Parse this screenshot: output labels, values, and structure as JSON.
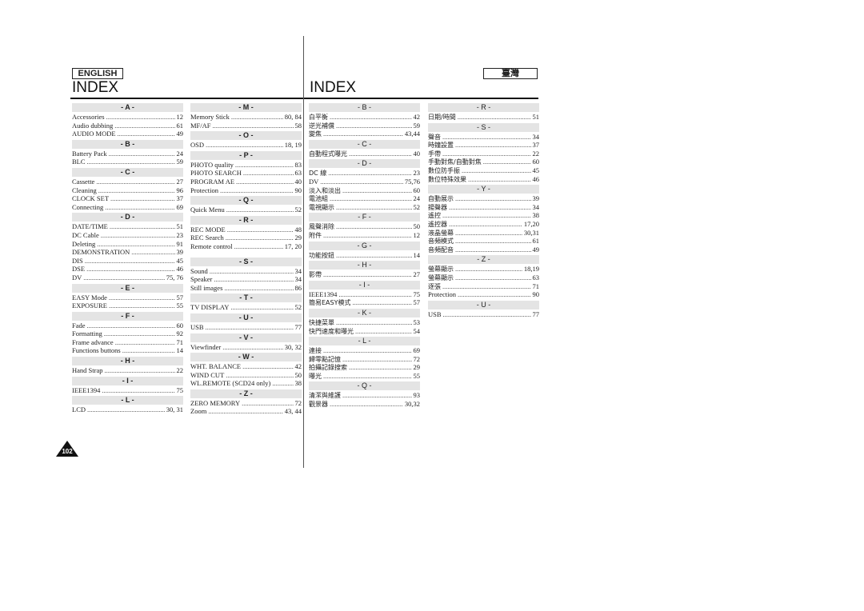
{
  "header": {
    "left_lang": "ENGLISH",
    "right_lang": "臺灣",
    "left_title": "INDEX",
    "right_title": "INDEX"
  },
  "page_number": "102",
  "col1": [
    {
      "letter": "- A -",
      "items": [
        [
          "Accessories",
          "12"
        ],
        [
          "Audio dubbing",
          "61"
        ],
        [
          "AUDIO MODE",
          "49"
        ]
      ]
    },
    {
      "letter": "- B -",
      "items": [
        [
          "Battery Pack",
          "24"
        ],
        [
          "BLC",
          "59"
        ]
      ]
    },
    {
      "letter": "- C -",
      "items": [
        [
          "Cassette",
          "27"
        ],
        [
          "Cleaning",
          "96"
        ],
        [
          "CLOCK SET",
          "37"
        ],
        [
          "Connecting",
          "69"
        ]
      ]
    },
    {
      "letter": "- D -",
      "items": [
        [
          "DATE/TIME",
          "51"
        ],
        [
          "DC Cable",
          "23"
        ],
        [
          "Deleting",
          "91"
        ],
        [
          "DEMONSTRATION",
          "39"
        ],
        [
          "DIS",
          "45"
        ],
        [
          "DSE",
          "46"
        ],
        [
          "DV",
          "75, 76"
        ]
      ]
    },
    {
      "letter": "- E -",
      "items": [
        [
          "EASY Mode",
          "57"
        ],
        [
          "EXPOSURE",
          "55"
        ]
      ]
    },
    {
      "letter": "- F -",
      "items": [
        [
          "Fade",
          "60"
        ],
        [
          "Formatting",
          "92"
        ],
        [
          "Frame advance",
          "71"
        ],
        [
          "Functions buttons",
          "14"
        ]
      ]
    },
    {
      "letter": "- H -",
      "items": [
        [
          "Hand Strap",
          "22"
        ]
      ]
    },
    {
      "letter": "- I -",
      "items": [
        [
          "IEEE1394",
          "75"
        ]
      ]
    },
    {
      "letter": "- L -",
      "items": [
        [
          "LCD",
          "30, 31"
        ]
      ]
    }
  ],
  "col2": [
    {
      "letter": "- M -",
      "items": [
        [
          "Memory Stick",
          "80, 84"
        ],
        [
          "MF/AF",
          "58"
        ]
      ]
    },
    {
      "letter": "- O -",
      "items": [
        [
          "OSD",
          "18, 19"
        ]
      ]
    },
    {
      "letter": "- P -",
      "items": [
        [
          "PHOTO quality",
          "83"
        ],
        [
          "PHOTO SEARCH",
          "63"
        ],
        [
          "PROGRAM AE",
          "40"
        ],
        [
          "Protection",
          "90"
        ]
      ]
    },
    {
      "letter": "- Q -",
      "items": [
        [
          "Quick Menu",
          "52"
        ]
      ]
    },
    {
      "letter": "- R -",
      "items": [
        [
          "REC MODE",
          "48"
        ],
        [
          "REC Search",
          "29"
        ],
        [
          "Remote control",
          "17, 20"
        ]
      ]
    },
    {
      "letter": "- S -",
      "items": [
        [
          "Sound",
          "34"
        ],
        [
          "Speaker",
          "34"
        ],
        [
          "Still images",
          "86"
        ]
      ]
    },
    {
      "letter": "- T -",
      "items": [
        [
          "TV DISPLAY",
          "52"
        ]
      ]
    },
    {
      "letter": "- U -",
      "items": [
        [
          "USB",
          "77"
        ]
      ]
    },
    {
      "letter": "- V -",
      "items": [
        [
          "Viewfinder",
          "30, 32"
        ]
      ]
    },
    {
      "letter": "- W -",
      "items": [
        [
          "WHT. BALANCE",
          "42"
        ],
        [
          "WIND CUT",
          "50"
        ],
        [
          "WL.REMOTE (SCD24 only)",
          "38"
        ]
      ]
    },
    {
      "letter": "- Z -",
      "items": [
        [
          "ZERO MEMORY",
          "72"
        ],
        [
          "Zoom",
          "43, 44"
        ]
      ]
    }
  ],
  "col3": [
    {
      "letter": "- B -",
      "items": [
        [
          "白平衡",
          "42"
        ],
        [
          "逆光補償",
          "59"
        ],
        [
          "變焦",
          "43,44"
        ]
      ]
    },
    {
      "letter": "- C -",
      "items": [
        [
          "自動程式曝光",
          "40"
        ]
      ]
    },
    {
      "letter": "- D -",
      "items": [
        [
          "DC 線",
          "23"
        ],
        [
          "DV",
          "75,76"
        ],
        [
          "淡入和淡出",
          "60"
        ],
        [
          "電池組",
          "24"
        ],
        [
          "電視顯示",
          "52"
        ]
      ]
    },
    {
      "letter": "- F -",
      "items": [
        [
          "風聲消除",
          "50"
        ],
        [
          "附件",
          "12"
        ]
      ]
    },
    {
      "letter": "- G -",
      "items": [
        [
          "功能按鈕",
          "14"
        ]
      ]
    },
    {
      "letter": "- H -",
      "items": [
        [
          "影帶",
          "27"
        ]
      ]
    },
    {
      "letter": "- I -",
      "items": [
        [
          "IEEE1394",
          "75"
        ],
        [
          "簡易EASY模式",
          "57"
        ]
      ]
    },
    {
      "letter": "- K -",
      "items": [
        [
          "快捷菜單",
          "53"
        ],
        [
          "快門速度和曝光",
          "54"
        ]
      ]
    },
    {
      "letter": "- L -",
      "items": [
        [
          "連接",
          "69"
        ],
        [
          "歸零點記憶",
          "72"
        ],
        [
          "拍攝記錄搜索",
          "29"
        ],
        [
          "曝光",
          "55"
        ]
      ]
    },
    {
      "letter": "- Q -",
      "items": [
        [
          "清潔與維護",
          "93"
        ],
        [
          "觀景器",
          "30,32"
        ]
      ]
    }
  ],
  "col4": [
    {
      "letter": "- R -",
      "items": [
        [
          "日期/時間",
          "51"
        ]
      ]
    },
    {
      "letter": "- S -",
      "items": [
        [
          "聲音",
          "34"
        ],
        [
          "時鐘設置",
          "37"
        ],
        [
          "手帶",
          "22"
        ],
        [
          "手動對焦/自動對焦",
          "60"
        ],
        [
          "數位防手振",
          "45"
        ],
        [
          "數位特殊效果",
          "46"
        ]
      ]
    },
    {
      "letter": "- Y -",
      "items": [
        [
          "自動展示",
          "39"
        ],
        [
          "揚聲器",
          "34"
        ],
        [
          "遙控",
          "38"
        ],
        [
          "遙控器",
          "17,20"
        ],
        [
          "液晶螢幕",
          "30,31"
        ],
        [
          "音頻模式",
          "61"
        ],
        [
          "音頻配音",
          "49"
        ]
      ]
    },
    {
      "letter": "- Z -",
      "items": [
        [
          "螢幕顯示",
          "18,19"
        ],
        [
          "螢幕顯示",
          "63"
        ],
        [
          "逐張",
          "71"
        ],
        [
          "Protection",
          "90"
        ]
      ]
    },
    {
      "letter": "- U -",
      "items": [
        [
          "USB",
          "77"
        ]
      ]
    }
  ]
}
